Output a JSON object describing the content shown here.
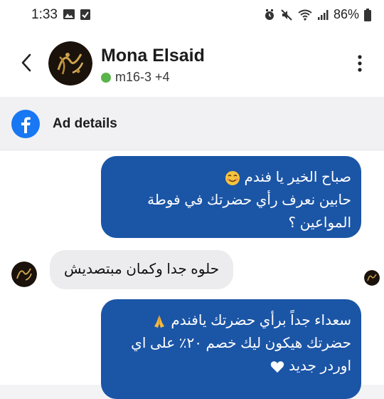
{
  "status": {
    "time": "1:33",
    "battery": "86%",
    "left_icons": [
      "gallery-icon",
      "clipboard-check-icon"
    ],
    "right_icons": [
      "alarm-icon",
      "mute-icon",
      "wifi-icon",
      "signal-icon",
      "battery-icon"
    ]
  },
  "header": {
    "name": "Mona Elsaid",
    "subtitle": "m16-3 +4",
    "online_color": "#5bb34b"
  },
  "ad": {
    "label": "Ad details",
    "brand_color": "#1877f2"
  },
  "messages": [
    {
      "direction": "out",
      "lines": [
        "صباح الخير يا فندم",
        "حابين نعرف رأي حضرتك في فوطة",
        "المواعين ؟"
      ],
      "emoji": "smiling-face-icon"
    },
    {
      "direction": "in",
      "text": "حلوه جدا وكمان مبتصديش"
    },
    {
      "direction": "out",
      "lines": [
        "سعداء جداً برأي حضرتك يافندم",
        "حضرتك هيكون ليك خصم ٢٠٪ على اي",
        "اوردر جديد"
      ],
      "emoji": [
        "folded-hands-icon",
        "white-heart-icon"
      ]
    }
  ],
  "colors": {
    "outgoing_bubble": "#1b55a6",
    "incoming_bubble": "#ececee"
  }
}
